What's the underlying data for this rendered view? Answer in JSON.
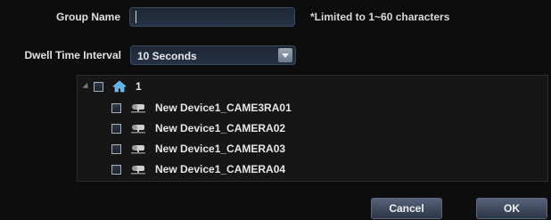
{
  "form": {
    "group_name_label": "Group Name",
    "group_name_value": "",
    "group_name_hint": "*Limited to 1~60 characters",
    "dwell_label": "Dwell Time Interval",
    "dwell_value": "10 Seconds"
  },
  "tree": {
    "root": {
      "label": "1",
      "icon": "home-icon"
    },
    "items": [
      {
        "label": "New Device1_CAME3RA01",
        "icon": "camera-icon"
      },
      {
        "label": "New Device1_CAMERA02",
        "icon": "camera-icon"
      },
      {
        "label": "New Device1_CAMERA03",
        "icon": "camera-icon"
      },
      {
        "label": "New Device1_CAMERA04",
        "icon": "camera-icon"
      }
    ]
  },
  "buttons": {
    "cancel": "Cancel",
    "ok": "OK"
  }
}
